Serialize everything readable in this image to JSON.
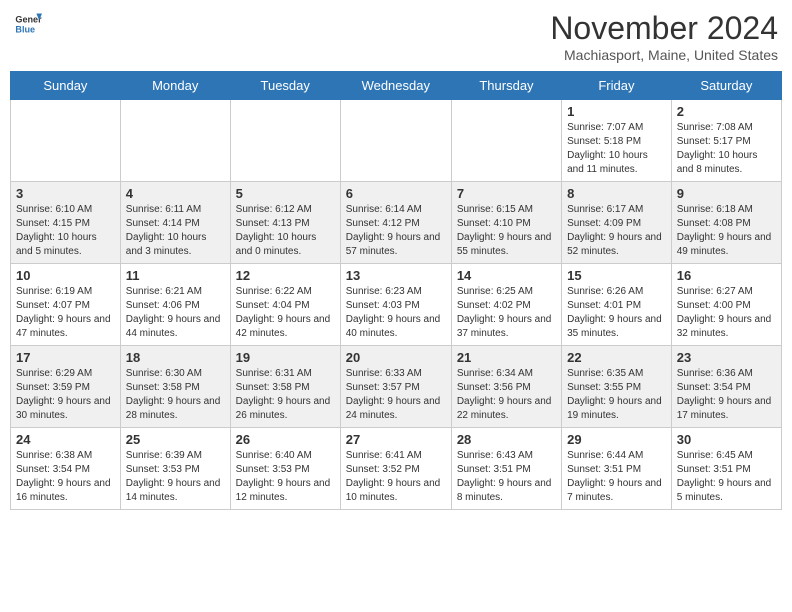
{
  "header": {
    "logo_line1": "General",
    "logo_line2": "Blue",
    "month": "November 2024",
    "location": "Machiasport, Maine, United States"
  },
  "days_of_week": [
    "Sunday",
    "Monday",
    "Tuesday",
    "Wednesday",
    "Thursday",
    "Friday",
    "Saturday"
  ],
  "weeks": [
    [
      {
        "day": "",
        "info": ""
      },
      {
        "day": "",
        "info": ""
      },
      {
        "day": "",
        "info": ""
      },
      {
        "day": "",
        "info": ""
      },
      {
        "day": "",
        "info": ""
      },
      {
        "day": "1",
        "info": "Sunrise: 7:07 AM\nSunset: 5:18 PM\nDaylight: 10 hours and 11 minutes."
      },
      {
        "day": "2",
        "info": "Sunrise: 7:08 AM\nSunset: 5:17 PM\nDaylight: 10 hours and 8 minutes."
      }
    ],
    [
      {
        "day": "3",
        "info": "Sunrise: 6:10 AM\nSunset: 4:15 PM\nDaylight: 10 hours and 5 minutes."
      },
      {
        "day": "4",
        "info": "Sunrise: 6:11 AM\nSunset: 4:14 PM\nDaylight: 10 hours and 3 minutes."
      },
      {
        "day": "5",
        "info": "Sunrise: 6:12 AM\nSunset: 4:13 PM\nDaylight: 10 hours and 0 minutes."
      },
      {
        "day": "6",
        "info": "Sunrise: 6:14 AM\nSunset: 4:12 PM\nDaylight: 9 hours and 57 minutes."
      },
      {
        "day": "7",
        "info": "Sunrise: 6:15 AM\nSunset: 4:10 PM\nDaylight: 9 hours and 55 minutes."
      },
      {
        "day": "8",
        "info": "Sunrise: 6:17 AM\nSunset: 4:09 PM\nDaylight: 9 hours and 52 minutes."
      },
      {
        "day": "9",
        "info": "Sunrise: 6:18 AM\nSunset: 4:08 PM\nDaylight: 9 hours and 49 minutes."
      }
    ],
    [
      {
        "day": "10",
        "info": "Sunrise: 6:19 AM\nSunset: 4:07 PM\nDaylight: 9 hours and 47 minutes."
      },
      {
        "day": "11",
        "info": "Sunrise: 6:21 AM\nSunset: 4:06 PM\nDaylight: 9 hours and 44 minutes."
      },
      {
        "day": "12",
        "info": "Sunrise: 6:22 AM\nSunset: 4:04 PM\nDaylight: 9 hours and 42 minutes."
      },
      {
        "day": "13",
        "info": "Sunrise: 6:23 AM\nSunset: 4:03 PM\nDaylight: 9 hours and 40 minutes."
      },
      {
        "day": "14",
        "info": "Sunrise: 6:25 AM\nSunset: 4:02 PM\nDaylight: 9 hours and 37 minutes."
      },
      {
        "day": "15",
        "info": "Sunrise: 6:26 AM\nSunset: 4:01 PM\nDaylight: 9 hours and 35 minutes."
      },
      {
        "day": "16",
        "info": "Sunrise: 6:27 AM\nSunset: 4:00 PM\nDaylight: 9 hours and 32 minutes."
      }
    ],
    [
      {
        "day": "17",
        "info": "Sunrise: 6:29 AM\nSunset: 3:59 PM\nDaylight: 9 hours and 30 minutes."
      },
      {
        "day": "18",
        "info": "Sunrise: 6:30 AM\nSunset: 3:58 PM\nDaylight: 9 hours and 28 minutes."
      },
      {
        "day": "19",
        "info": "Sunrise: 6:31 AM\nSunset: 3:58 PM\nDaylight: 9 hours and 26 minutes."
      },
      {
        "day": "20",
        "info": "Sunrise: 6:33 AM\nSunset: 3:57 PM\nDaylight: 9 hours and 24 minutes."
      },
      {
        "day": "21",
        "info": "Sunrise: 6:34 AM\nSunset: 3:56 PM\nDaylight: 9 hours and 22 minutes."
      },
      {
        "day": "22",
        "info": "Sunrise: 6:35 AM\nSunset: 3:55 PM\nDaylight: 9 hours and 19 minutes."
      },
      {
        "day": "23",
        "info": "Sunrise: 6:36 AM\nSunset: 3:54 PM\nDaylight: 9 hours and 17 minutes."
      }
    ],
    [
      {
        "day": "24",
        "info": "Sunrise: 6:38 AM\nSunset: 3:54 PM\nDaylight: 9 hours and 16 minutes."
      },
      {
        "day": "25",
        "info": "Sunrise: 6:39 AM\nSunset: 3:53 PM\nDaylight: 9 hours and 14 minutes."
      },
      {
        "day": "26",
        "info": "Sunrise: 6:40 AM\nSunset: 3:53 PM\nDaylight: 9 hours and 12 minutes."
      },
      {
        "day": "27",
        "info": "Sunrise: 6:41 AM\nSunset: 3:52 PM\nDaylight: 9 hours and 10 minutes."
      },
      {
        "day": "28",
        "info": "Sunrise: 6:43 AM\nSunset: 3:51 PM\nDaylight: 9 hours and 8 minutes."
      },
      {
        "day": "29",
        "info": "Sunrise: 6:44 AM\nSunset: 3:51 PM\nDaylight: 9 hours and 7 minutes."
      },
      {
        "day": "30",
        "info": "Sunrise: 6:45 AM\nSunset: 3:51 PM\nDaylight: 9 hours and 5 minutes."
      }
    ]
  ]
}
